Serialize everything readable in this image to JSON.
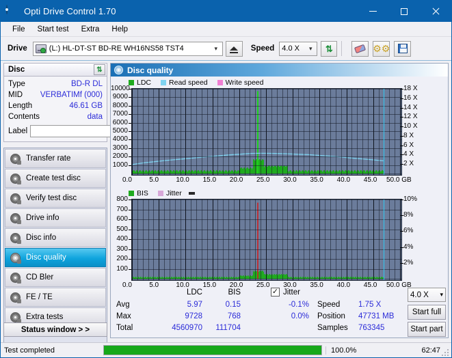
{
  "window": {
    "title": "Opti Drive Control 1.70",
    "icon": "disc-icon",
    "minimize": "–",
    "maximize": "□",
    "close": "✕"
  },
  "menu": {
    "items": [
      "File",
      "Start test",
      "Extra",
      "Help"
    ]
  },
  "toolbar": {
    "drive_label": "Drive",
    "drive_value": "(L:)  HL-DT-ST BD-RE  WH16NS58 TST4",
    "eject_icon": "eject-icon",
    "speed_label": "Speed",
    "speed_value": "4.0 X",
    "refresh_icon": "refresh-icon",
    "erase_icon": "erase-icon",
    "settings_icon": "gear-icon",
    "save_icon": "save-icon"
  },
  "disc_panel": {
    "title": "Disc",
    "refresh_icon": "refresh-icon",
    "rows": [
      {
        "key": "Type",
        "value": "BD-R DL"
      },
      {
        "key": "MID",
        "value": "VERBATIMf (000)"
      },
      {
        "key": "Length",
        "value": "46.61 GB"
      },
      {
        "key": "Contents",
        "value": "data"
      }
    ],
    "label_key": "Label",
    "label_value": "",
    "label_placeholder": "",
    "disc_button_icon": "cd-icon"
  },
  "nav": {
    "items": [
      {
        "label": "Transfer rate",
        "icon": "transfer-rate-icon",
        "active": false
      },
      {
        "label": "Create test disc",
        "icon": "create-test-disc-icon",
        "active": false
      },
      {
        "label": "Verify test disc",
        "icon": "verify-test-disc-icon",
        "active": false
      },
      {
        "label": "Drive info",
        "icon": "drive-info-icon",
        "active": false
      },
      {
        "label": "Disc info",
        "icon": "disc-info-icon",
        "active": false
      },
      {
        "label": "Disc quality",
        "icon": "disc-quality-icon",
        "active": true
      },
      {
        "label": "CD Bler",
        "icon": "cd-bler-icon",
        "active": false
      },
      {
        "label": "FE / TE",
        "icon": "fe-te-icon",
        "active": false
      },
      {
        "label": "Extra tests",
        "icon": "extra-tests-icon",
        "active": false
      }
    ],
    "status_window_label": "Status window > >"
  },
  "panel": {
    "title": "Disc quality",
    "icon": "disc-quality-icon"
  },
  "stats": {
    "col_ldc": "LDC",
    "col_bis": "BIS",
    "row_avg": "Avg",
    "row_max": "Max",
    "row_total": "Total",
    "ldc_avg": "5.97",
    "ldc_max": "9728",
    "ldc_total": "4560970",
    "bis_avg": "0.15",
    "bis_max": "768",
    "bis_total": "111704",
    "jitter_label": "Jitter",
    "jitter_checked": "✓",
    "jitter_avg": "-0.1%",
    "jitter_max": "0.0%",
    "speed_label": "Speed",
    "speed_value": "1.75 X",
    "position_label": "Position",
    "position_value": "47731 MB",
    "samples_label": "Samples",
    "samples_value": "763345",
    "speed_select": "4.0 X",
    "start_full": "Start full",
    "start_part": "Start part"
  },
  "statusbar": {
    "message": "Test completed",
    "percent_text": "100.0%",
    "percent_value": 100,
    "elapsed": "62:47"
  },
  "colors": {
    "accent": "#0a62ad",
    "ldc": "#1faa1f",
    "bis": "#1faa1f",
    "read_speed": "#7fd3f0",
    "write_speed": "#f07fd3",
    "jitter": "#d8a8d8",
    "plot_bg": "#6b7c9b",
    "progress": "#17a81a",
    "value_text": "#2b2bd8",
    "cursor_line": "#32c8f0",
    "spike_red": "#d02020"
  },
  "chart_data": [
    {
      "type": "line",
      "title": "Disc quality - LDC / speed",
      "xlabel": "GB",
      "ylabel": "LDC",
      "y2label": "X",
      "xlim": [
        0,
        50
      ],
      "ylim": [
        0,
        10000
      ],
      "y2lim": [
        0,
        18
      ],
      "grid": true,
      "legend": [
        "LDC",
        "Read speed",
        "Write speed"
      ],
      "legend_position": "top-left",
      "xticks": [
        "0.0",
        "5.0",
        "10.0",
        "15.0",
        "20.0",
        "25.0",
        "30.0",
        "35.0",
        "40.0",
        "45.0",
        "50.0 GB"
      ],
      "yticks": [
        "10000",
        "9000",
        "8000",
        "7000",
        "6000",
        "5000",
        "4000",
        "3000",
        "2000",
        "1000"
      ],
      "y2ticks": [
        "18 X",
        "16 X",
        "14 X",
        "12 X",
        "10 X",
        "8 X",
        "6 X",
        "4 X",
        "2 X"
      ],
      "series": [
        {
          "name": "Read speed",
          "axis": "y2",
          "color": "#7fd3f0",
          "x": [
            0,
            2,
            4,
            6,
            8,
            10,
            12,
            14,
            16,
            18,
            20,
            22,
            23.4,
            25,
            27,
            29,
            31,
            33,
            35,
            37,
            39,
            41,
            43,
            45,
            46.9
          ],
          "values": [
            1.9,
            2.25,
            2.5,
            2.75,
            2.95,
            3.15,
            3.35,
            3.55,
            3.75,
            3.95,
            4.1,
            4.25,
            4.3,
            4.3,
            4.25,
            4.2,
            4.1,
            4.0,
            3.85,
            3.7,
            3.5,
            3.3,
            3.1,
            2.9,
            2.7
          ]
        },
        {
          "name": "LDC",
          "axis": "y",
          "color": "#1faa1f",
          "description": "Dense low green scatter along baseline (avg 5.97) with a single tall spike reaching 9728 at approximately 23.4 GB",
          "baseline": 60,
          "spike_x": 23.4,
          "spike_y": 9728
        },
        {
          "name": "Write speed",
          "axis": "y2",
          "color": "#f07fd3",
          "values": []
        }
      ],
      "cursor_lines": [
        {
          "x": 46.9,
          "color": "#32c8f0"
        }
      ]
    },
    {
      "type": "line",
      "title": "Disc quality - BIS / jitter",
      "xlabel": "GB",
      "ylabel": "BIS",
      "y2label": "%",
      "xlim": [
        0,
        50
      ],
      "ylim": [
        0,
        800
      ],
      "y2lim": [
        0,
        10
      ],
      "grid": true,
      "legend": [
        "BIS",
        "Jitter"
      ],
      "legend_position": "top-left",
      "xticks": [
        "0.0",
        "5.0",
        "10.0",
        "15.0",
        "20.0",
        "25.0",
        "30.0",
        "35.0",
        "40.0",
        "45.0",
        "50.0 GB"
      ],
      "yticks": [
        "800",
        "700",
        "600",
        "500",
        "400",
        "300",
        "200",
        "100"
      ],
      "y2ticks": [
        "10%",
        "8%",
        "6%",
        "4%",
        "2%"
      ],
      "series": [
        {
          "name": "BIS",
          "axis": "y",
          "color": "#1faa1f",
          "description": "Low green baseline across the disc (avg 0.15) with small clusters near 23-29 GB",
          "baseline": 4,
          "spike_x": 23.4,
          "spike_y": 768
        },
        {
          "name": "Jitter",
          "axis": "y2",
          "color": "#d8a8d8",
          "values": []
        }
      ],
      "cursor_lines": [
        {
          "x": 46.9,
          "color": "#32c8f0"
        }
      ]
    }
  ]
}
